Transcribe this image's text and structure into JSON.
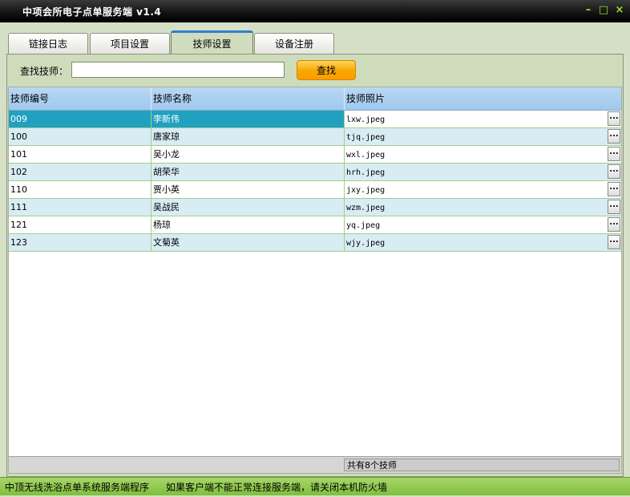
{
  "window": {
    "title": "中项会所电子点单服务端 v1.4",
    "min_glyph": "–",
    "max_glyph": "□",
    "close_glyph": "×"
  },
  "tabs": [
    {
      "label": "链接日志"
    },
    {
      "label": "项目设置"
    },
    {
      "label": "技师设置",
      "active": true
    },
    {
      "label": "设备注册"
    }
  ],
  "search": {
    "label": "查找技师：",
    "value": "",
    "button": "查找"
  },
  "table": {
    "columns": [
      "技师编号",
      "技师名称",
      "技师照片"
    ],
    "rows": [
      {
        "id": "009",
        "name": "李新伟",
        "photo": "lxw.jpeg",
        "selected": true
      },
      {
        "id": "100",
        "name": "唐家琼",
        "photo": "tjq.jpeg"
      },
      {
        "id": "101",
        "name": "吴小龙",
        "photo": "wxl.jpeg"
      },
      {
        "id": "102",
        "name": "胡荣华",
        "photo": "hrh.jpeg"
      },
      {
        "id": "110",
        "name": "贾小英",
        "photo": "jxy.jpeg"
      },
      {
        "id": "111",
        "name": "吴战民",
        "photo": "wzm.jpeg"
      },
      {
        "id": "121",
        "name": "杨琼",
        "photo": "yq.jpeg"
      },
      {
        "id": "123",
        "name": "文菊英",
        "photo": "wjy.jpeg"
      }
    ],
    "ellipsis": "...",
    "total": "共有8个技师"
  },
  "status": {
    "left": "中顶无线洗浴点单系统服务端程序",
    "right": "如果客户端不能正常连接服务端，请关闭本机防火墙"
  },
  "colors": {
    "selected_row": "#21a0c0",
    "alt_row": "#d8ecf4",
    "accent_button": "#f7a600",
    "status_bar": "#8cc84a"
  }
}
